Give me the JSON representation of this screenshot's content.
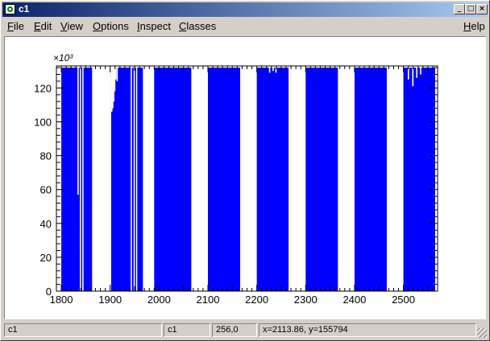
{
  "window": {
    "title": "c1",
    "min_glyph": "_",
    "max_glyph": "□",
    "close_glyph": "×"
  },
  "menu": {
    "file": "File",
    "edit": "Edit",
    "view": "View",
    "options": "Options",
    "inspect": "Inspect",
    "classes": "Classes",
    "help": "Help"
  },
  "status": {
    "object": "c1",
    "canvas": "c1",
    "pixel": "256,0",
    "coords": "x=2113.86, y=155794"
  },
  "colors": {
    "bar": "#0000ff",
    "titlebar_start": "#0a246a",
    "titlebar_end": "#a6caf0"
  },
  "chart_data": {
    "type": "bar",
    "title": "",
    "xlabel": "",
    "ylabel": "",
    "y_exponent_label": "×10³",
    "xlim": [
      1790,
      2570
    ],
    "ylim": [
      0,
      133000
    ],
    "x_ticks": [
      "1800",
      "1900",
      "2000",
      "2100",
      "2200",
      "2300",
      "2400",
      "2500"
    ],
    "y_ticks": [
      "0",
      "20",
      "40",
      "60",
      "80",
      "100",
      "120"
    ],
    "grid": false,
    "baseline_value": 132000,
    "filled_ranges": [
      [
        1800,
        1863
      ],
      [
        1902,
        1967
      ],
      [
        1990,
        2066
      ],
      [
        2100,
        2166
      ],
      [
        2200,
        2265
      ],
      [
        2300,
        2366
      ],
      [
        2400,
        2466
      ],
      [
        2500,
        2565
      ]
    ],
    "dips": [
      {
        "x": 1833,
        "value": 57000
      },
      {
        "x": 1902,
        "value": 106000
      },
      {
        "x": 1904,
        "value": 108000
      },
      {
        "x": 1906,
        "value": 112000
      },
      {
        "x": 1908,
        "value": 118000
      },
      {
        "x": 1910,
        "value": 125000
      },
      {
        "x": 1913,
        "value": 124000
      },
      {
        "x": 2225,
        "value": 129000
      },
      {
        "x": 2232,
        "value": 130000
      },
      {
        "x": 2238,
        "value": 129000
      },
      {
        "x": 2509,
        "value": 125000
      },
      {
        "x": 2518,
        "value": 121000
      },
      {
        "x": 2526,
        "value": 126000
      },
      {
        "x": 2534,
        "value": 128000
      }
    ],
    "gaps": [
      1838,
      1843,
      1942,
      1948,
      1953
    ]
  }
}
